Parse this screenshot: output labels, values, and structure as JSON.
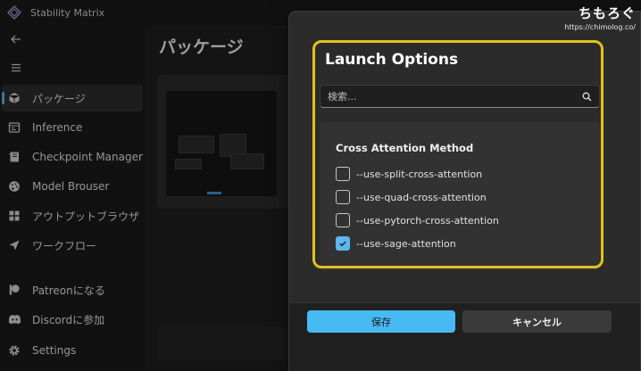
{
  "app": {
    "title": "Stability Matrix",
    "logo_icon": "stability-matrix-logo-icon"
  },
  "sidebar": {
    "back_icon": "arrow-left-icon",
    "menu_icon": "hamburger-icon",
    "items": [
      {
        "label": "パッケージ",
        "icon": "package-box-icon",
        "active": true
      },
      {
        "label": "Inference",
        "icon": "inference-window-icon",
        "active": false
      },
      {
        "label": "Checkpoint Manager",
        "icon": "notebook-icon",
        "active": false
      },
      {
        "label": "Model Brouser",
        "icon": "palette-icon",
        "active": false
      },
      {
        "label": "アウトプットブラウザ",
        "icon": "grid-icon",
        "active": false
      },
      {
        "label": "ワークフロー",
        "icon": "send-icon",
        "active": false
      },
      {
        "label": "Patreonになる",
        "icon": "patreon-icon",
        "active": false
      },
      {
        "label": "Discordに参加",
        "icon": "discord-icon",
        "active": false
      },
      {
        "label": "Settings",
        "icon": "gear-icon",
        "active": false
      }
    ]
  },
  "main": {
    "page_title": "パッケージ"
  },
  "dialog": {
    "title": "Launch Options",
    "search": {
      "placeholder": "検索...",
      "value": "",
      "icon": "search-icon"
    },
    "group_title": "Cross Attention Method",
    "options": [
      {
        "label": "--use-split-cross-attention",
        "checked": false
      },
      {
        "label": "--use-quad-cross-attention",
        "checked": false
      },
      {
        "label": "--use-pytorch-cross-attention",
        "checked": false
      },
      {
        "label": "--use-sage-attention",
        "checked": true
      }
    ],
    "save_label": "保存",
    "cancel_label": "キャンセル"
  },
  "watermark": {
    "logo_text": "ちもろぐ",
    "url": "https://chimolog.co/"
  },
  "colors": {
    "accent": "#47b9f3",
    "highlight_border": "#e2c21a",
    "background": "#1b1b1b",
    "dialog_bg": "#2b2b2b"
  }
}
